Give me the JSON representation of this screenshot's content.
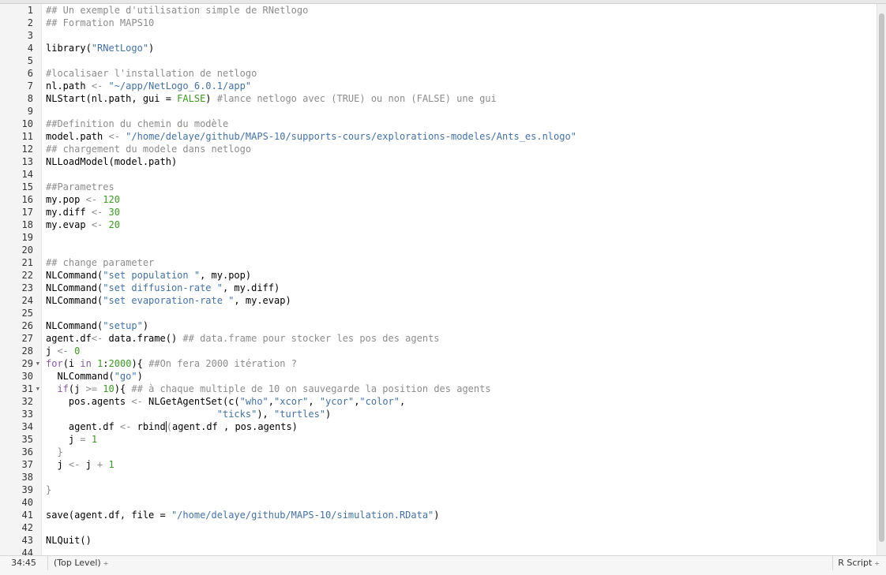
{
  "editor": {
    "lines": [
      [
        [
          "comment",
          "## Un exemple d'utilisation simple de RNetlogo"
        ]
      ],
      [
        [
          "comment",
          "## Formation MAPS10"
        ]
      ],
      [],
      [
        [
          "text",
          "library("
        ],
        [
          "string",
          "\"RNetLogo\""
        ],
        [
          "text",
          ")"
        ]
      ],
      [],
      [
        [
          "comment",
          "#localisaer l'installation de netlogo"
        ]
      ],
      [
        [
          "text",
          "nl.path "
        ],
        [
          "op",
          "<-"
        ],
        [
          "text",
          " "
        ],
        [
          "string",
          "\"~/app/NetLogo_6.0.1/app\""
        ]
      ],
      [
        [
          "text",
          "NLStart(nl.path, gui = "
        ],
        [
          "const",
          "FALSE"
        ],
        [
          "text",
          ") "
        ],
        [
          "comment",
          "#lance netlogo avec (TRUE) ou non (FALSE) une gui"
        ]
      ],
      [],
      [
        [
          "comment",
          "##Definition du chemin du modèle"
        ]
      ],
      [
        [
          "text",
          "model.path "
        ],
        [
          "op",
          "<-"
        ],
        [
          "text",
          " "
        ],
        [
          "string",
          "\"/home/delaye/github/MAPS-10/supports-cours/explorations-modeles/Ants_es.nlogo\""
        ]
      ],
      [
        [
          "comment",
          "## chargement du modele dans netlogo"
        ]
      ],
      [
        [
          "text",
          "NLLoadModel(model.path)"
        ]
      ],
      [],
      [
        [
          "comment",
          "##Parametres"
        ]
      ],
      [
        [
          "text",
          "my.pop "
        ],
        [
          "op",
          "<-"
        ],
        [
          "text",
          " "
        ],
        [
          "number",
          "120"
        ]
      ],
      [
        [
          "text",
          "my.diff "
        ],
        [
          "op",
          "<-"
        ],
        [
          "text",
          " "
        ],
        [
          "number",
          "30"
        ]
      ],
      [
        [
          "text",
          "my.evap "
        ],
        [
          "op",
          "<-"
        ],
        [
          "text",
          " "
        ],
        [
          "number",
          "20"
        ]
      ],
      [],
      [],
      [
        [
          "comment",
          "## change parameter"
        ]
      ],
      [
        [
          "text",
          "NLCommand("
        ],
        [
          "string",
          "\"set population \""
        ],
        [
          "text",
          ", my.pop)"
        ]
      ],
      [
        [
          "text",
          "NLCommand("
        ],
        [
          "string",
          "\"set diffusion-rate \""
        ],
        [
          "text",
          ", my.diff)"
        ]
      ],
      [
        [
          "text",
          "NLCommand("
        ],
        [
          "string",
          "\"set evaporation-rate \""
        ],
        [
          "text",
          ", my.evap)"
        ]
      ],
      [],
      [
        [
          "text",
          "NLCommand("
        ],
        [
          "string",
          "\"setup\""
        ],
        [
          "text",
          ")"
        ]
      ],
      [
        [
          "text",
          "agent.df"
        ],
        [
          "op",
          "<-"
        ],
        [
          "text",
          " data.frame() "
        ],
        [
          "comment",
          "## data.frame pour stocker les pos des agents"
        ]
      ],
      [
        [
          "text",
          "j "
        ],
        [
          "op",
          "<-"
        ],
        [
          "text",
          " "
        ],
        [
          "number",
          "0"
        ]
      ],
      [
        [
          "keyword",
          "for"
        ],
        [
          "text",
          "(i "
        ],
        [
          "keyword",
          "in"
        ],
        [
          "text",
          " "
        ],
        [
          "number",
          "1"
        ],
        [
          "text",
          ":"
        ],
        [
          "number",
          "2000"
        ],
        [
          "text",
          ")"
        ],
        [
          "text",
          "{ "
        ],
        [
          "comment",
          "##On fera 2000 itération ?"
        ]
      ],
      [
        [
          "text",
          "  NLCommand("
        ],
        [
          "string",
          "\"go\""
        ],
        [
          "text",
          ")"
        ]
      ],
      [
        [
          "text",
          "  "
        ],
        [
          "keyword",
          "if"
        ],
        [
          "text",
          "(j "
        ],
        [
          "op",
          ">="
        ],
        [
          "text",
          " "
        ],
        [
          "number",
          "10"
        ],
        [
          "text",
          ")"
        ],
        [
          "text",
          "{ "
        ],
        [
          "comment",
          "## à chaque multiple de 10 on sauvegarde la position des agents"
        ]
      ],
      [
        [
          "text",
          "    pos.agents "
        ],
        [
          "op",
          "<-"
        ],
        [
          "text",
          " NLGetAgentSet(c("
        ],
        [
          "string",
          "\"who\""
        ],
        [
          "text",
          ","
        ],
        [
          "string",
          "\"xcor\""
        ],
        [
          "text",
          ", "
        ],
        [
          "string",
          "\"ycor\""
        ],
        [
          "text",
          ","
        ],
        [
          "string",
          "\"color\""
        ],
        [
          "text",
          ","
        ]
      ],
      [
        [
          "text",
          "                              "
        ],
        [
          "string",
          "\"ticks\""
        ],
        [
          "text",
          "), "
        ],
        [
          "string",
          "\"turtles\""
        ],
        [
          "text",
          ")"
        ]
      ],
      [
        [
          "text",
          "    agent.df "
        ],
        [
          "op",
          "<-"
        ],
        [
          "text",
          " rbind"
        ],
        [
          "cursor",
          "("
        ],
        [
          "text",
          "agent.df , pos.agents)"
        ]
      ],
      [
        [
          "text",
          "    j "
        ],
        [
          "op",
          "="
        ],
        [
          "text",
          " "
        ],
        [
          "number",
          "1"
        ]
      ],
      [
        [
          "op",
          "  }"
        ]
      ],
      [
        [
          "text",
          "  j "
        ],
        [
          "op",
          "<-"
        ],
        [
          "text",
          " j "
        ],
        [
          "op",
          "+"
        ],
        [
          "text",
          " "
        ],
        [
          "number",
          "1"
        ]
      ],
      [],
      [
        [
          "op",
          "}"
        ]
      ],
      [],
      [
        [
          "text",
          "save(agent.df, file = "
        ],
        [
          "string",
          "\"/home/delaye/github/MAPS-10/simulation.RData\""
        ],
        [
          "text",
          ")"
        ]
      ],
      [],
      [
        [
          "text",
          "NLQuit()"
        ]
      ],
      []
    ],
    "fold_lines": [
      29,
      31
    ]
  },
  "status": {
    "position": "34:45",
    "scope": "(Top Level)",
    "file_type": "R Script",
    "caret": "÷"
  }
}
